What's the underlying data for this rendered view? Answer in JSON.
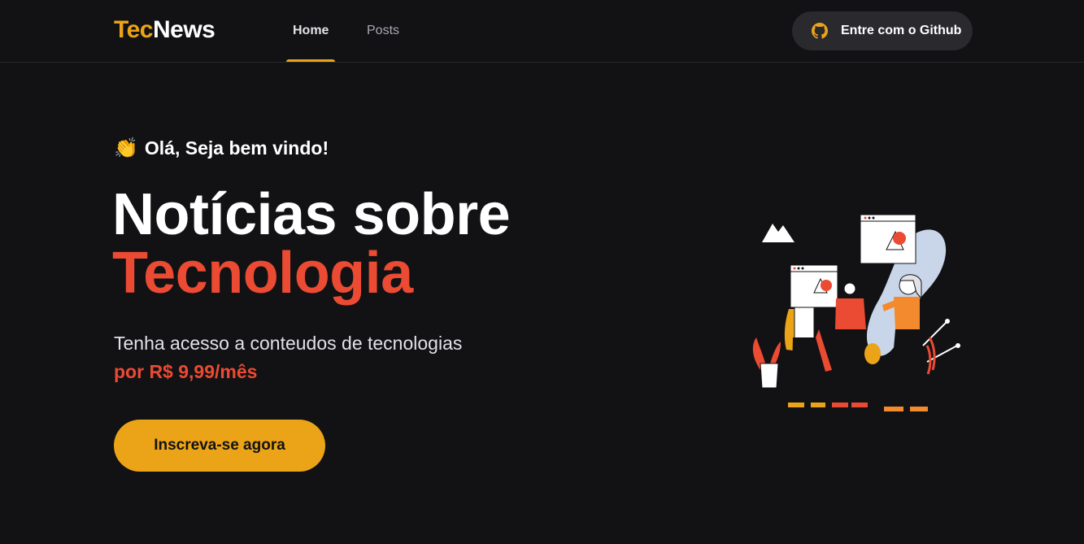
{
  "header": {
    "logo_part1": "Tec",
    "logo_part2": "News",
    "nav": [
      {
        "label": "Home",
        "active": true
      },
      {
        "label": "Posts",
        "active": false
      }
    ],
    "github_button": {
      "label": "Entre com o Github",
      "icon": "github-icon"
    }
  },
  "hero": {
    "greeting_emoji": "👏",
    "greeting": "Olá, Seja bem vindo!",
    "title_line1": "Notícias sobre",
    "title_line2": "Tecnologia",
    "subtitle": "Tenha acesso a conteudos de tecnologias",
    "price": "por R$ 9,99/mês",
    "cta_label": "Inscreva-se agora",
    "illustration": "people-with-screens-illustration"
  },
  "colors": {
    "background": "#121214",
    "accent_yellow": "#eba417",
    "accent_red": "#eb4a33",
    "button_dark": "#29292e"
  }
}
